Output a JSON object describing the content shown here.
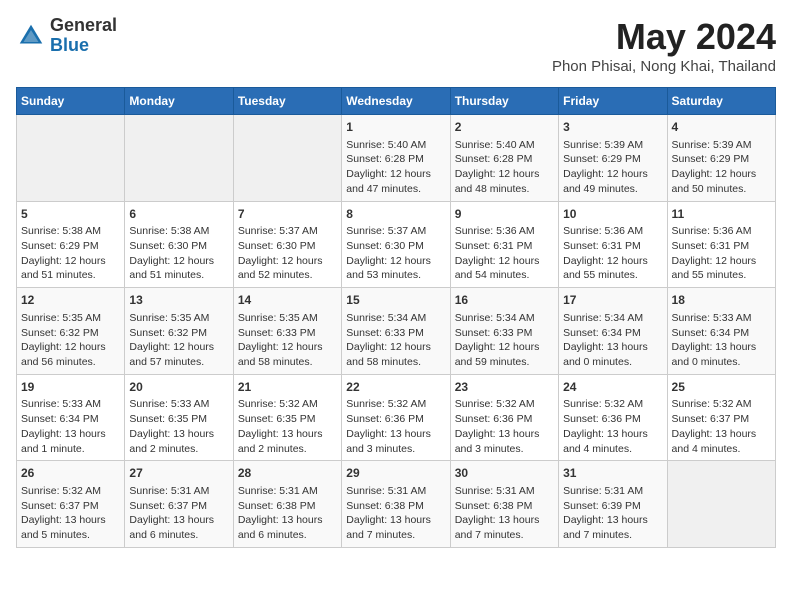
{
  "logo": {
    "general": "General",
    "blue": "Blue"
  },
  "title": "May 2024",
  "subtitle": "Phon Phisai, Nong Khai, Thailand",
  "weekdays": [
    "Sunday",
    "Monday",
    "Tuesday",
    "Wednesday",
    "Thursday",
    "Friday",
    "Saturday"
  ],
  "weeks": [
    [
      {
        "day": "",
        "content": ""
      },
      {
        "day": "",
        "content": ""
      },
      {
        "day": "",
        "content": ""
      },
      {
        "day": "1",
        "content": "Sunrise: 5:40 AM\nSunset: 6:28 PM\nDaylight: 12 hours\nand 47 minutes."
      },
      {
        "day": "2",
        "content": "Sunrise: 5:40 AM\nSunset: 6:28 PM\nDaylight: 12 hours\nand 48 minutes."
      },
      {
        "day": "3",
        "content": "Sunrise: 5:39 AM\nSunset: 6:29 PM\nDaylight: 12 hours\nand 49 minutes."
      },
      {
        "day": "4",
        "content": "Sunrise: 5:39 AM\nSunset: 6:29 PM\nDaylight: 12 hours\nand 50 minutes."
      }
    ],
    [
      {
        "day": "5",
        "content": "Sunrise: 5:38 AM\nSunset: 6:29 PM\nDaylight: 12 hours\nand 51 minutes."
      },
      {
        "day": "6",
        "content": "Sunrise: 5:38 AM\nSunset: 6:30 PM\nDaylight: 12 hours\nand 51 minutes."
      },
      {
        "day": "7",
        "content": "Sunrise: 5:37 AM\nSunset: 6:30 PM\nDaylight: 12 hours\nand 52 minutes."
      },
      {
        "day": "8",
        "content": "Sunrise: 5:37 AM\nSunset: 6:30 PM\nDaylight: 12 hours\nand 53 minutes."
      },
      {
        "day": "9",
        "content": "Sunrise: 5:36 AM\nSunset: 6:31 PM\nDaylight: 12 hours\nand 54 minutes."
      },
      {
        "day": "10",
        "content": "Sunrise: 5:36 AM\nSunset: 6:31 PM\nDaylight: 12 hours\nand 55 minutes."
      },
      {
        "day": "11",
        "content": "Sunrise: 5:36 AM\nSunset: 6:31 PM\nDaylight: 12 hours\nand 55 minutes."
      }
    ],
    [
      {
        "day": "12",
        "content": "Sunrise: 5:35 AM\nSunset: 6:32 PM\nDaylight: 12 hours\nand 56 minutes."
      },
      {
        "day": "13",
        "content": "Sunrise: 5:35 AM\nSunset: 6:32 PM\nDaylight: 12 hours\nand 57 minutes."
      },
      {
        "day": "14",
        "content": "Sunrise: 5:35 AM\nSunset: 6:33 PM\nDaylight: 12 hours\nand 58 minutes."
      },
      {
        "day": "15",
        "content": "Sunrise: 5:34 AM\nSunset: 6:33 PM\nDaylight: 12 hours\nand 58 minutes."
      },
      {
        "day": "16",
        "content": "Sunrise: 5:34 AM\nSunset: 6:33 PM\nDaylight: 12 hours\nand 59 minutes."
      },
      {
        "day": "17",
        "content": "Sunrise: 5:34 AM\nSunset: 6:34 PM\nDaylight: 13 hours\nand 0 minutes."
      },
      {
        "day": "18",
        "content": "Sunrise: 5:33 AM\nSunset: 6:34 PM\nDaylight: 13 hours\nand 0 minutes."
      }
    ],
    [
      {
        "day": "19",
        "content": "Sunrise: 5:33 AM\nSunset: 6:34 PM\nDaylight: 13 hours\nand 1 minute."
      },
      {
        "day": "20",
        "content": "Sunrise: 5:33 AM\nSunset: 6:35 PM\nDaylight: 13 hours\nand 2 minutes."
      },
      {
        "day": "21",
        "content": "Sunrise: 5:32 AM\nSunset: 6:35 PM\nDaylight: 13 hours\nand 2 minutes."
      },
      {
        "day": "22",
        "content": "Sunrise: 5:32 AM\nSunset: 6:36 PM\nDaylight: 13 hours\nand 3 minutes."
      },
      {
        "day": "23",
        "content": "Sunrise: 5:32 AM\nSunset: 6:36 PM\nDaylight: 13 hours\nand 3 minutes."
      },
      {
        "day": "24",
        "content": "Sunrise: 5:32 AM\nSunset: 6:36 PM\nDaylight: 13 hours\nand 4 minutes."
      },
      {
        "day": "25",
        "content": "Sunrise: 5:32 AM\nSunset: 6:37 PM\nDaylight: 13 hours\nand 4 minutes."
      }
    ],
    [
      {
        "day": "26",
        "content": "Sunrise: 5:32 AM\nSunset: 6:37 PM\nDaylight: 13 hours\nand 5 minutes."
      },
      {
        "day": "27",
        "content": "Sunrise: 5:31 AM\nSunset: 6:37 PM\nDaylight: 13 hours\nand 6 minutes."
      },
      {
        "day": "28",
        "content": "Sunrise: 5:31 AM\nSunset: 6:38 PM\nDaylight: 13 hours\nand 6 minutes."
      },
      {
        "day": "29",
        "content": "Sunrise: 5:31 AM\nSunset: 6:38 PM\nDaylight: 13 hours\nand 7 minutes."
      },
      {
        "day": "30",
        "content": "Sunrise: 5:31 AM\nSunset: 6:38 PM\nDaylight: 13 hours\nand 7 minutes."
      },
      {
        "day": "31",
        "content": "Sunrise: 5:31 AM\nSunset: 6:39 PM\nDaylight: 13 hours\nand 7 minutes."
      },
      {
        "day": "",
        "content": ""
      }
    ]
  ]
}
